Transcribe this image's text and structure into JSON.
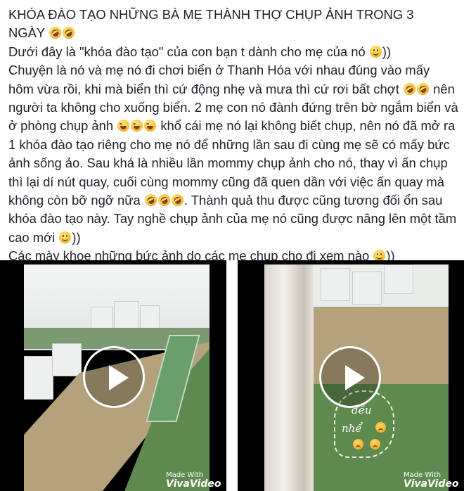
{
  "post": {
    "title_line1": "KHÓA ĐÀO TẠO NHỮNG BÀ MẸ THÀNH THỢ CHỤP ẢNH TRONG 3",
    "title_line2": "NGÀY",
    "p1": "Dưới đây là \"khóa đào tạo\" của con bạn t dành cho mẹ của nó",
    "p1_end": "))",
    "p2_a": "Chuyện là nó và mẹ nó đi chơi biển ở Thanh Hóa với nhau đúng vào mấy hôm vừa rồi, khi mà biển thì cứ động nhẹ và mưa thì cứ rơi bất chợt",
    "p2_b": "nên người ta không cho xuống biển. 2 mẹ con nó đành đứng trên bờ ngắm biển và ở phòng chụp ảnh",
    "p2_c": "khổ cái mẹ nó lại không biết chụp, nên nó đã mở ra 1 khóa đào tạo riêng cho mẹ nó để những lần sau đi cùng mẹ sẽ có mấy bức ảnh sống ảo. Sau khá là nhiều lần mommy chụp ảnh cho nó, thay vì ấn chụp thì lại dí nút quay, cuối cùng mommy cũng đã quen dần với việc ấn quay mà không còn bỡ ngỡ nữa",
    "p2_d": ". Thành quả thu được cũng tương đối ổn sau khóa đào tạo này. Tay nghề chụp ảnh của mẹ nó cũng được nâng lên một tầm cao mới",
    "p2_end": "))",
    "p3": "Các mày khoe những bức ảnh do các mẹ chụp cho đi xem nào",
    "p3_end": "))"
  },
  "emoji_names": [
    "rofl-emoji",
    "smile-emoji",
    "grin-squint-emoji"
  ],
  "videos": [
    {
      "watermark_made": "Made With",
      "watermark_brand": "VivaVideo"
    },
    {
      "watermark_made": "Made With",
      "watermark_brand": "VivaVideo",
      "handwriting_1": "đều",
      "handwriting_2": "nhể"
    }
  ],
  "colors": {
    "video_bg": "#000000",
    "text": "#1d2129",
    "play_button": "#ffffff"
  }
}
